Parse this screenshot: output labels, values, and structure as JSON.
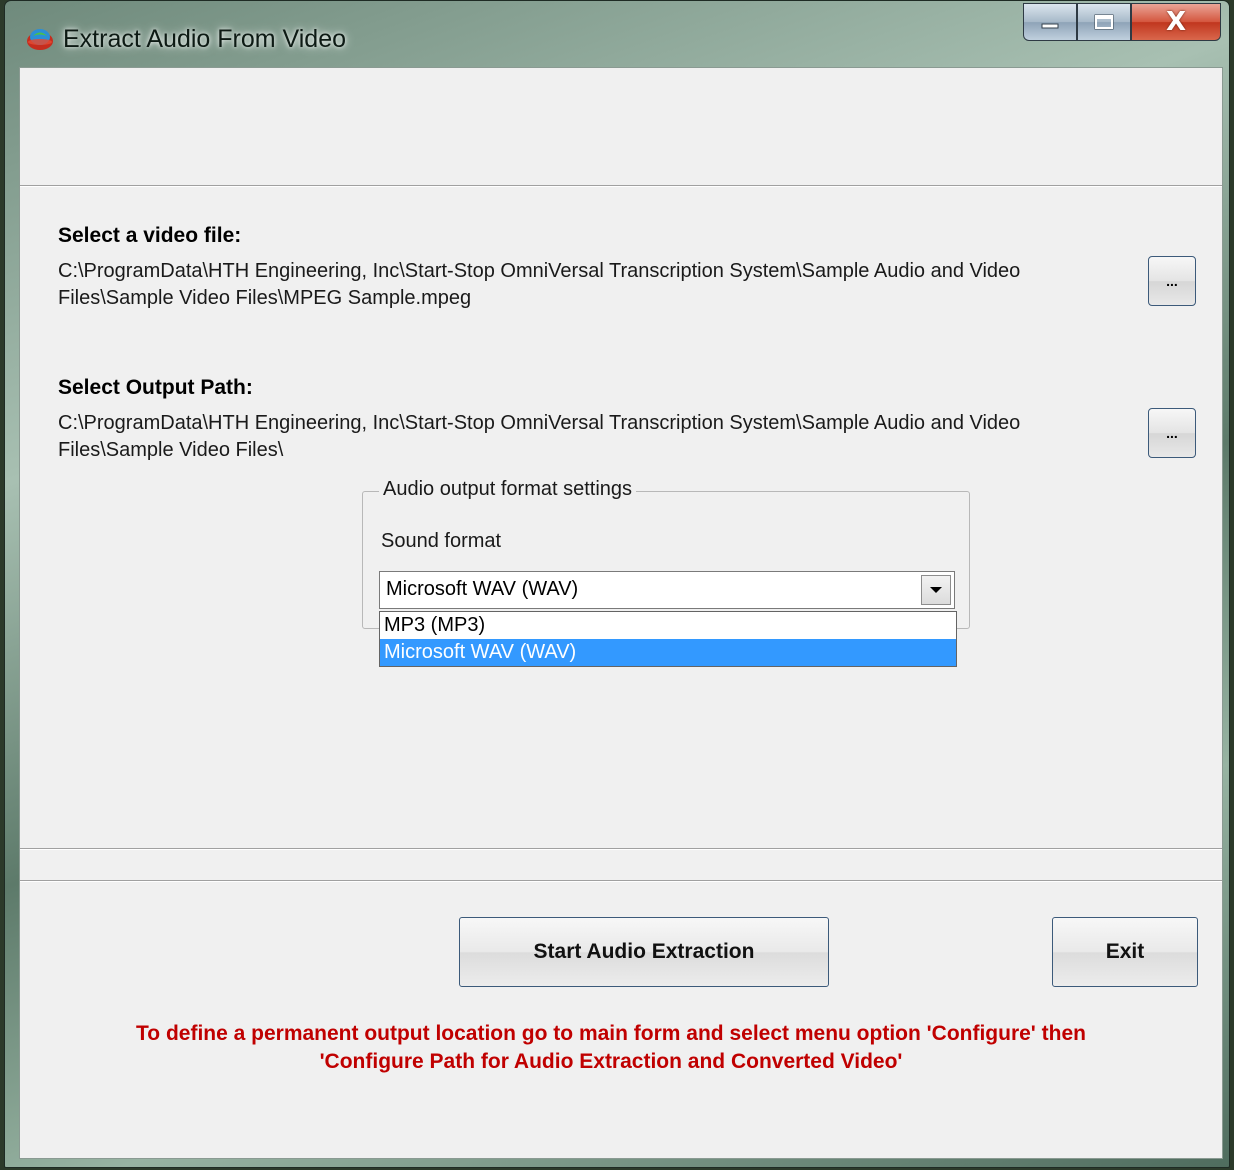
{
  "window": {
    "title": "Extract Audio From Video",
    "caption_buttons": [
      "minimize",
      "maximize",
      "close"
    ],
    "close_glyph": "X"
  },
  "video_file": {
    "label": "Select a video file:",
    "path": "C:\\ProgramData\\HTH Engineering, Inc\\Start-Stop OmniVersal Transcription System\\Sample Audio and Video Files\\Sample Video Files\\MPEG Sample.mpeg",
    "browse_label": "..."
  },
  "output_path": {
    "label": "Select Output Path:",
    "path": "C:\\ProgramData\\HTH Engineering, Inc\\Start-Stop OmniVersal Transcription System\\Sample Audio and Video Files\\Sample Video Files\\",
    "browse_label": "..."
  },
  "audio_settings": {
    "group_title": "Audio output format settings",
    "sound_format_label": "Sound format",
    "selected": "Microsoft WAV (WAV)",
    "options": [
      "MP3 (MP3)",
      "Microsoft WAV (WAV)"
    ],
    "highlighted_index": 1
  },
  "actions": {
    "start_label": "Start Audio Extraction",
    "exit_label": "Exit"
  },
  "notice": {
    "line1": "To define a permanent output location go to  main form and select menu option 'Configure' then",
    "line2": "'Configure Path for Audio Extraction and Converted Video'"
  },
  "colors": {
    "notice": "#c00000",
    "selection": "#3399ff",
    "close_button": "#c0361e"
  }
}
